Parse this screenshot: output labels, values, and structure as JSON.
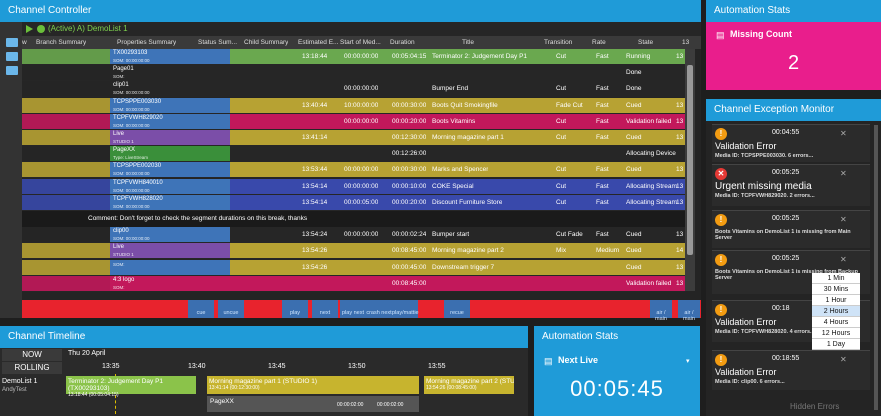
{
  "controller": {
    "title": "Channel Controller",
    "list_status": "(Active) A) DemoList 1",
    "columns": [
      "w",
      "Branch Summary",
      "Properties Summary",
      "Status Sum...",
      "Child Summary",
      "Estimated E...",
      "Start of Med...",
      "Duration",
      "Title",
      "Transition",
      "Rate",
      "State",
      "13"
    ],
    "rows": [
      {
        "id": "TX00293103",
        "sub": "SOM: 00:00:00:00",
        "est": "13:18:44",
        "som": "00:00:00:00",
        "dur": "00:05:04:15",
        "title": "Terminator 2: Judgement Day P1",
        "trans": "Cut",
        "rate": "Fast",
        "state": "Running",
        "n": "13",
        "bg": "#6aa84f",
        "pc": "#3e74b8"
      },
      {
        "id": "Page01",
        "sub": "SOM:",
        "est": "",
        "som": "",
        "dur": "",
        "title": "",
        "trans": "",
        "rate": "",
        "state": "Done",
        "n": "",
        "bg": "#262626",
        "pc": "#262626"
      },
      {
        "id": "clip01",
        "sub": "SOM: 00:00:00:00",
        "est": "",
        "som": "00:00:00:00",
        "dur": "",
        "title": "Bumper End",
        "trans": "Cut",
        "rate": "Fast",
        "state": "Done",
        "n": "",
        "bg": "#262626",
        "pc": "#262626"
      },
      {
        "id": "TCPSPPE003030",
        "sub": "SOM: 00:00:00:00",
        "est": "13:40:44",
        "som": "10:00:00:00",
        "dur": "00:00:30:00",
        "title": "Boots Quit Smokingfile",
        "trans": "Fade Cut",
        "rate": "Fast",
        "state": "Cued",
        "n": "13",
        "bg": "#b7a233",
        "pc": "#3e74b8"
      },
      {
        "id": "TCPFVWH829020",
        "sub": "SOM: 00:00:00:00",
        "est": "",
        "som": "00:00:00:00",
        "dur": "00:00:20:00",
        "title": "Boots Vitamins",
        "trans": "Cut",
        "rate": "Fast",
        "state": "Validation failed",
        "n": "13",
        "bg": "#c2185b",
        "pc": "#3e74b8"
      },
      {
        "id": "Live",
        "sub": "STUDIO 1",
        "est": "13:41:14",
        "som": "",
        "dur": "00:12:30:00",
        "title": "Morning magazine part 1",
        "trans": "Cut",
        "rate": "Fast",
        "state": "Cued",
        "n": "13",
        "bg": "#b7a233",
        "pc": "#7b4ea8"
      },
      {
        "id": "PageXX",
        "sub": "Type: LiveStream",
        "est": "",
        "som": "",
        "dur": "00:12:26:00",
        "title": "",
        "trans": "",
        "rate": "",
        "state": "Allocating Device",
        "n": "",
        "bg": "#262626",
        "pc": "#3a8f3a"
      },
      {
        "id": "TCPSPPE002030",
        "sub": "SOM: 00:00:00:00",
        "est": "13:53:44",
        "som": "00:00:00:00",
        "dur": "00:00:30:00",
        "title": "Marks and Spencer",
        "trans": "Cut",
        "rate": "Fast",
        "state": "Cued",
        "n": "13",
        "bg": "#b7a233",
        "pc": "#3e74b8"
      },
      {
        "id": "TCPFVWH840010",
        "sub": "SOM: 00:00:00:00",
        "est": "13:54:14",
        "som": "00:00:00:00",
        "dur": "00:00:10:00",
        "title": "COKE Special",
        "trans": "Cut",
        "rate": "Fast",
        "state": "Allocating Stream",
        "n": "13",
        "bg": "#3949ab",
        "pc": "#3e74b8"
      },
      {
        "id": "TCPFVWH828020",
        "sub": "SOM: 00:00:00:00",
        "est": "13:54:14",
        "som": "00:00:05:00",
        "dur": "00:00:20:00",
        "title": "Discount Furniture Store",
        "trans": "Cut",
        "rate": "Fast",
        "state": "Allocating Stream",
        "n": "13",
        "bg": "#3949ab",
        "pc": "#3e74b8"
      },
      {
        "id": "",
        "sub": "",
        "est": "",
        "som": "",
        "dur": "",
        "title": "",
        "trans": "",
        "rate": "",
        "state": "",
        "n": "",
        "bg": "#262626",
        "pc": "#262626"
      },
      {
        "id": "clip00",
        "sub": "SOM: 00:00:00:00",
        "est": "13:54:24",
        "som": "00:00:00:00",
        "dur": "00:00:02:24",
        "title": "Bumper start",
        "trans": "Cut Fade",
        "rate": "Fast",
        "state": "Cued",
        "n": "13",
        "bg": "#262626",
        "pc": "#3e74b8"
      },
      {
        "id": "Live",
        "sub": "STUDIO 1",
        "est": "13:54:26",
        "som": "",
        "dur": "00:08:45:00",
        "title": "Morning magazine part 2",
        "trans": "Mix",
        "rate": "Medium",
        "state": "Cued",
        "n": "14",
        "bg": "#b7a233",
        "pc": "#7b4ea8"
      },
      {
        "id": "",
        "sub": "SOM:",
        "est": "13:54:26",
        "som": "",
        "dur": "00:00:45:00",
        "title": "Downstream trigger 7",
        "trans": "",
        "rate": "",
        "state": "Cued",
        "n": "13",
        "bg": "#b7a233",
        "pc": "#3e74b8"
      },
      {
        "id": "4:3 logo",
        "sub": "SOM:",
        "est": "",
        "som": "",
        "dur": "00:08:45:00",
        "title": "",
        "trans": "",
        "rate": "",
        "state": "Validation failed",
        "n": "13",
        "bg": "#c2185b",
        "pc": "#c2185b"
      }
    ],
    "comment": "Comment: Don't forget to check the segment durations on this break, thanks",
    "toolbar": [
      "cue",
      "uncue",
      "play",
      "next",
      "play next",
      "crash next",
      "play/mattie",
      "recue",
      "air / main",
      "air / main"
    ]
  },
  "timeline": {
    "title": "Channel Timeline",
    "now": "NOW",
    "rolling": "ROLLING",
    "date": "Thu 20 April",
    "ticks": [
      "13:35",
      "13:40",
      "13:45",
      "13:50",
      "13:55"
    ],
    "list": "DemoList 1",
    "user": "AndyTest",
    "items": [
      {
        "label": "Terminator 2: Judgement Day P1 (TX00293103)",
        "time": "13:18:44 (00:05:04:15)"
      },
      {
        "label": "Morning magazine part 1 (STUDIO 1)",
        "time": "13:41:14 (00:12:30:00)"
      },
      {
        "label": "Morning magazine part 2 (STUDIO 1)",
        "time": "13:54:26 (00:08:45:00)"
      }
    ],
    "sub": "PageXX",
    "sub_time": "00:00:02:00",
    "sub_time2": "00:00:02:00"
  },
  "stats1": {
    "title": "Automation Stats",
    "label": "Missing Count",
    "value": "2",
    "color": "#e91e8c"
  },
  "stats2": {
    "title": "Automation Stats",
    "label": "Next Live",
    "value": "00:05:45"
  },
  "exceptions": {
    "title": "Channel Exception Monitor",
    "items": [
      {
        "time": "00:04:55",
        "title": "Validation Error",
        "media": "Media ID: TCPSPPE003030. 6 errors..."
      },
      {
        "time": "00:05:25",
        "title": "Urgent missing media",
        "media": "Media ID: TCPFVWH829020. 2 errors..."
      },
      {
        "time": "00:05:25",
        "title": "",
        "media": "Boots Vitamins on DemoList 1 is missing from Main Server"
      },
      {
        "time": "00:05:25",
        "title": "",
        "media": "Boots Vitamins on DemoList 1 is missing from Backup Server"
      },
      {
        "time": "00:18",
        "title": "Validation Error",
        "media": "Media ID: TCPFVWH828020. 4 errors..."
      },
      {
        "time": "00:18:55",
        "title": "Validation Error",
        "media": "Media ID: clip00. 6 errors..."
      }
    ],
    "hidden": "Hidden Errors",
    "dropdown": [
      "1 Min",
      "30 Mins",
      "1 Hour",
      "2 Hours",
      "4 Hours",
      "12 Hours",
      "1 Day"
    ],
    "dropdown_selected": "2 Hours"
  }
}
